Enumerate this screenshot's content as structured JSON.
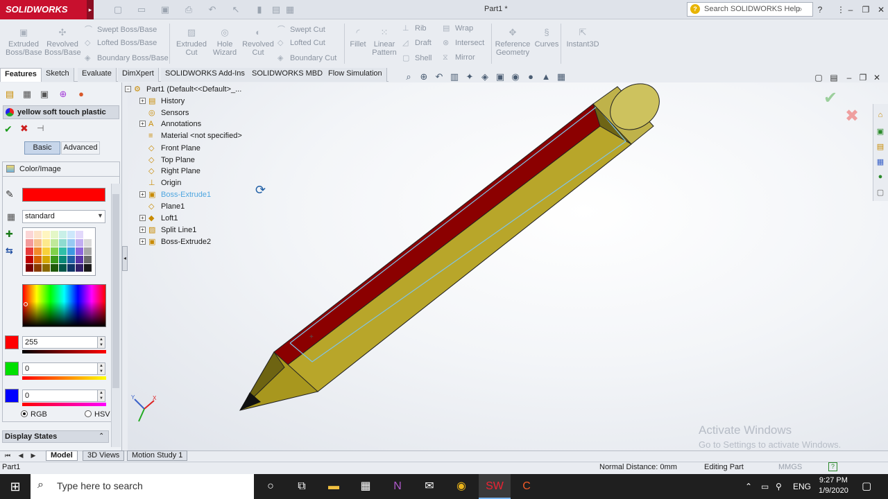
{
  "app": {
    "logo": "SOLIDWORKS",
    "document_title": "Part1 *"
  },
  "search": {
    "placeholder": "Search SOLIDWORKS Help"
  },
  "commands": {
    "extruded_boss": "Extruded Boss/Base",
    "revolved_boss": "Revolved Boss/Base",
    "swept_boss": "Swept Boss/Base",
    "lofted_boss": "Lofted Boss/Base",
    "boundary_boss": "Boundary Boss/Base",
    "extruded_cut": "Extruded Cut",
    "hole_wizard": "Hole Wizard",
    "revolved_cut": "Revolved Cut",
    "swept_cut": "Swept Cut",
    "lofted_cut": "Lofted Cut",
    "boundary_cut": "Boundary Cut",
    "fillet": "Fillet",
    "linear_pattern": "Linear Pattern",
    "rib": "Rib",
    "draft": "Draft",
    "shell": "Shell",
    "wrap": "Wrap",
    "intersect": "Intersect",
    "mirror": "Mirror",
    "reference_geometry": "Reference Geometry",
    "curves": "Curves",
    "instant3d": "Instant3D"
  },
  "tabs": [
    "Features",
    "Sketch",
    "Evaluate",
    "DimXpert",
    "SOLIDWORKS Add-Ins",
    "SOLIDWORKS MBD",
    "Flow Simulation"
  ],
  "appearance_panel": {
    "material_name": "yellow soft touch plastic",
    "basic": "Basic",
    "advanced": "Advanced",
    "section": "Color/Image",
    "palette": "standard",
    "current_color": "#ff0000",
    "r_value": "255",
    "g_value": "0",
    "b_value": "0",
    "rgb_label": "RGB",
    "hsv_label": "HSV",
    "display_states": "Display States"
  },
  "feature_tree": {
    "root": "Part1  (Default<<Default>_...",
    "items": [
      {
        "label": "History",
        "icon": "folder-icon",
        "expandable": true
      },
      {
        "label": "Sensors",
        "icon": "sensor-icon",
        "expandable": false
      },
      {
        "label": "Annotations",
        "icon": "annotation-icon",
        "expandable": true
      },
      {
        "label": "Material <not specified>",
        "icon": "material-icon",
        "expandable": false
      },
      {
        "label": "Front Plane",
        "icon": "plane-icon",
        "expandable": false
      },
      {
        "label": "Top Plane",
        "icon": "plane-icon",
        "expandable": false
      },
      {
        "label": "Right Plane",
        "icon": "plane-icon",
        "expandable": false
      },
      {
        "label": "Origin",
        "icon": "origin-icon",
        "expandable": false
      },
      {
        "label": "Boss-Extrude1",
        "icon": "extrude-icon",
        "expandable": true,
        "selected": true
      },
      {
        "label": "Plane1",
        "icon": "plane-icon",
        "expandable": false
      },
      {
        "label": "Loft1",
        "icon": "loft-icon",
        "expandable": true
      },
      {
        "label": "Split Line1",
        "icon": "splitline-icon",
        "expandable": true
      },
      {
        "label": "Boss-Extrude2",
        "icon": "extrude-icon",
        "expandable": true
      }
    ]
  },
  "viewport": {
    "activate_title": "Activate Windows",
    "activate_sub": "Go to Settings to activate Windows.",
    "colors": {
      "pencil_body": "#b8a62a",
      "pencil_stripe": "#8b0000",
      "eraser": "#cdc25e"
    }
  },
  "bottom_tabs": [
    "Model",
    "3D Views",
    "Motion Study 1"
  ],
  "status": {
    "doc": "Part1",
    "normal_distance": "Normal Distance: 0mm",
    "mode": "Editing Part",
    "units": "MMGS"
  },
  "taskbar": {
    "search_placeholder": "Type here to search",
    "lang": "ENG",
    "time": "9:27 PM",
    "date": "1/9/2020"
  }
}
